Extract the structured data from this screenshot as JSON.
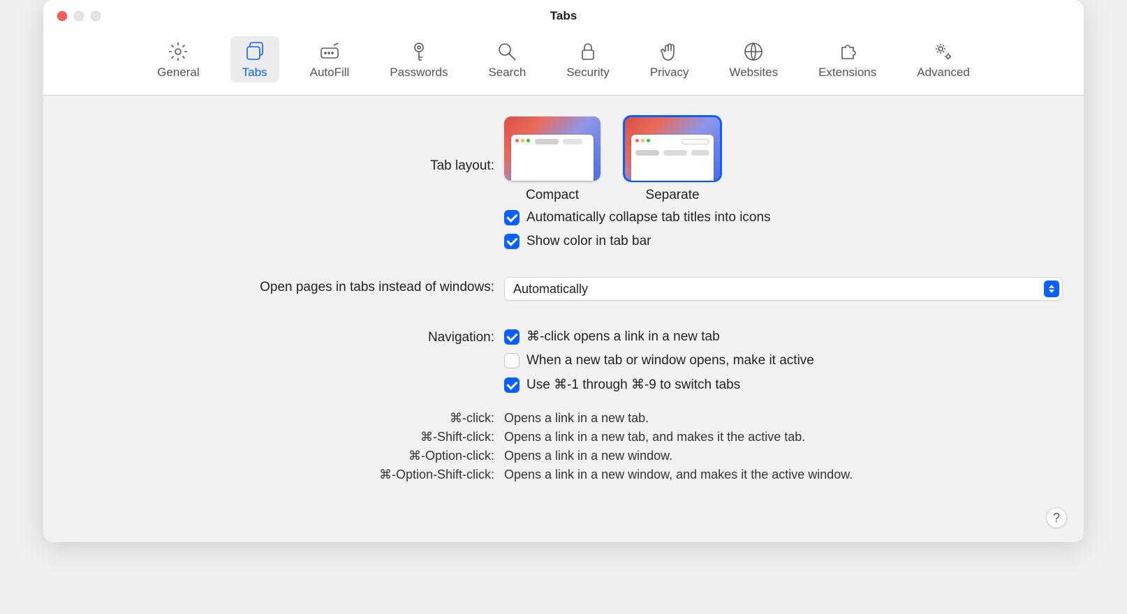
{
  "window": {
    "title": "Tabs"
  },
  "toolbar": {
    "items": [
      {
        "id": "general",
        "label": "General"
      },
      {
        "id": "tabs",
        "label": "Tabs",
        "active": true
      },
      {
        "id": "autofill",
        "label": "AutoFill"
      },
      {
        "id": "passwords",
        "label": "Passwords"
      },
      {
        "id": "search",
        "label": "Search"
      },
      {
        "id": "security",
        "label": "Security"
      },
      {
        "id": "privacy",
        "label": "Privacy"
      },
      {
        "id": "websites",
        "label": "Websites"
      },
      {
        "id": "extensions",
        "label": "Extensions"
      },
      {
        "id": "advanced",
        "label": "Advanced"
      }
    ]
  },
  "tab_layout": {
    "label": "Tab layout:",
    "options": [
      {
        "id": "compact",
        "caption": "Compact",
        "selected": false
      },
      {
        "id": "separate",
        "caption": "Separate",
        "selected": true
      }
    ],
    "auto_collapse": {
      "checked": true,
      "label": "Automatically collapse tab titles into icons"
    },
    "show_color": {
      "checked": true,
      "label": "Show color in tab bar"
    }
  },
  "open_in_tabs": {
    "label": "Open pages in tabs instead of windows:",
    "value": "Automatically"
  },
  "navigation": {
    "label": "Navigation:",
    "cmd_click": {
      "checked": true,
      "label": "⌘-click opens a link in a new tab"
    },
    "make_active": {
      "checked": false,
      "label": "When a new tab or window opens, make it active"
    },
    "cmd_number": {
      "checked": true,
      "label": "Use ⌘-1 through ⌘-9 to switch tabs"
    }
  },
  "hints": [
    {
      "k": "⌘-click:",
      "v": "Opens a link in a new tab."
    },
    {
      "k": "⌘-Shift-click:",
      "v": "Opens a link in a new tab, and makes it the active tab."
    },
    {
      "k": "⌘-Option-click:",
      "v": "Opens a link in a new window."
    },
    {
      "k": "⌘-Option-Shift-click:",
      "v": "Opens a link in a new window, and makes it the active window."
    }
  ],
  "help": "?"
}
